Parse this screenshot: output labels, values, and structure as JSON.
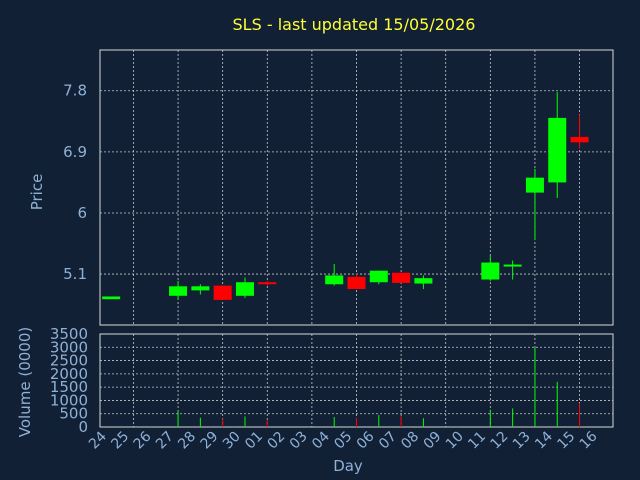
{
  "colors": {
    "background": "#112035",
    "title": "#ffff33",
    "axis_text": "#8fb1d6",
    "frame": "#d8d8d8",
    "grid": "#c8c8c8",
    "up": "#00ff00",
    "down": "#ff0000"
  },
  "chart_data": {
    "type": "candlestick",
    "title": "SLS - last updated 15/05/2026",
    "xlabel": "Day",
    "price_panel": {
      "ylabel": "Price",
      "ylim": [
        4.35,
        8.4
      ],
      "yticks": [
        "5.1",
        "6",
        "6.9",
        "7.8"
      ],
      "grid": true
    },
    "volume_panel": {
      "ylabel": "Volume (0000)",
      "ylim": [
        0,
        3500
      ],
      "yticks": [
        "0",
        "500",
        "1000",
        "1500",
        "2000",
        "2500",
        "3000",
        "3500"
      ],
      "grid": true
    },
    "categories": [
      "24",
      "25",
      "26",
      "27",
      "28",
      "29",
      "30",
      "01",
      "02",
      "03",
      "04",
      "05",
      "06",
      "07",
      "08",
      "09",
      "10",
      "11",
      "12",
      "13",
      "14",
      "15",
      "16"
    ],
    "candles": [
      {
        "day": "24",
        "open": 4.73,
        "close": 4.77,
        "high": 4.77,
        "low": 4.73,
        "volume": 0
      },
      {
        "day": "27",
        "open": 4.78,
        "close": 4.92,
        "high": 5.0,
        "low": 4.72,
        "volume": 600
      },
      {
        "day": "28",
        "open": 4.86,
        "close": 4.92,
        "high": 4.95,
        "low": 4.8,
        "volume": 350
      },
      {
        "day": "29",
        "open": 4.93,
        "close": 4.72,
        "high": 4.93,
        "low": 4.72,
        "volume": 320
      },
      {
        "day": "30",
        "open": 4.78,
        "close": 4.98,
        "high": 5.05,
        "low": 4.75,
        "volume": 400
      },
      {
        "day": "01",
        "open": 4.98,
        "close": 4.96,
        "high": 5.0,
        "low": 4.93,
        "volume": 280
      },
      {
        "day": "04",
        "open": 4.95,
        "close": 5.08,
        "high": 5.25,
        "low": 4.93,
        "volume": 380
      },
      {
        "day": "05",
        "open": 5.06,
        "close": 4.88,
        "high": 5.1,
        "low": 4.88,
        "volume": 350
      },
      {
        "day": "06",
        "open": 4.98,
        "close": 5.15,
        "high": 5.15,
        "low": 4.95,
        "volume": 450
      },
      {
        "day": "07",
        "open": 5.12,
        "close": 4.97,
        "high": 5.12,
        "low": 4.97,
        "volume": 420
      },
      {
        "day": "08",
        "open": 4.96,
        "close": 5.04,
        "high": 5.08,
        "low": 4.88,
        "volume": 330
      },
      {
        "day": "11",
        "open": 5.02,
        "close": 5.27,
        "high": 5.38,
        "low": 5.0,
        "volume": 650
      },
      {
        "day": "12",
        "open": 5.22,
        "close": 5.24,
        "high": 5.3,
        "low": 5.02,
        "volume": 700
      },
      {
        "day": "13",
        "open": 6.3,
        "close": 6.52,
        "high": 6.65,
        "low": 5.6,
        "volume": 3000
      },
      {
        "day": "14",
        "open": 6.45,
        "close": 7.4,
        "high": 7.78,
        "low": 6.22,
        "volume": 1700
      },
      {
        "day": "15",
        "open": 7.12,
        "close": 7.04,
        "high": 7.45,
        "low": 6.95,
        "volume": 900
      }
    ]
  }
}
